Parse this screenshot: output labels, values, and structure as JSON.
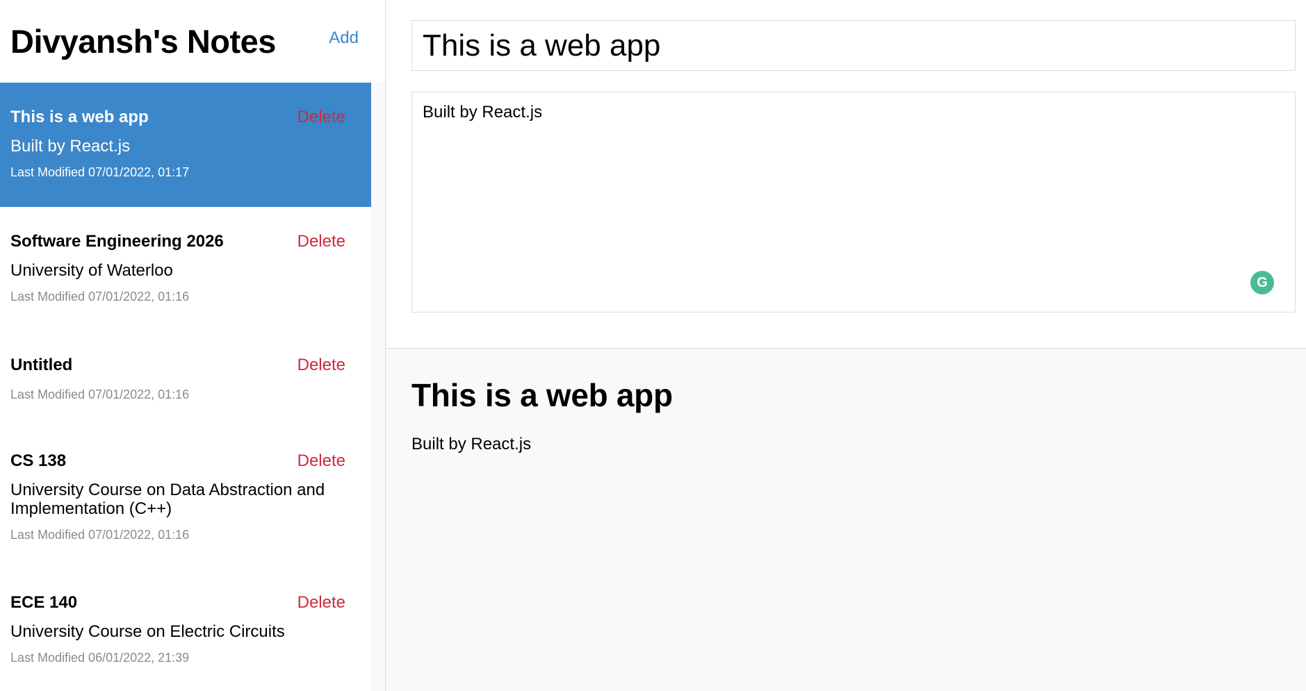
{
  "sidebar": {
    "title": "Divyansh's Notes",
    "add_label": "Add",
    "notes": [
      {
        "title": "This is a web app",
        "body": "Built by React.js",
        "modified": "Last Modified 07/01/2022, 01:17",
        "delete_label": "Delete",
        "active": true
      },
      {
        "title": "Software Engineering 2026",
        "body": "University of Waterloo",
        "modified": "Last Modified 07/01/2022, 01:16",
        "delete_label": "Delete"
      },
      {
        "title": "Untitled",
        "body": "",
        "modified": "Last Modified 07/01/2022, 01:16",
        "delete_label": "Delete"
      },
      {
        "title": "CS 138",
        "body": "University Course on Data Abstraction and Implementation (C++)",
        "modified": "Last Modified 07/01/2022, 01:16",
        "delete_label": "Delete"
      },
      {
        "title": "ECE 140",
        "body": "University Course on Electric Circuits",
        "modified": "Last Modified 06/01/2022, 21:39",
        "delete_label": "Delete"
      }
    ]
  },
  "editor": {
    "title_value": "This is a web app",
    "body_value": "Built by React.js",
    "grammarly_glyph": "G"
  },
  "preview": {
    "title": "This is a web app",
    "body": "Built by React.js"
  },
  "colors": {
    "active_note_bg": "#3b87c9",
    "delete_red": "#d1293d",
    "add_blue": "#3a88c9",
    "grammarly_green": "#4aba98"
  }
}
